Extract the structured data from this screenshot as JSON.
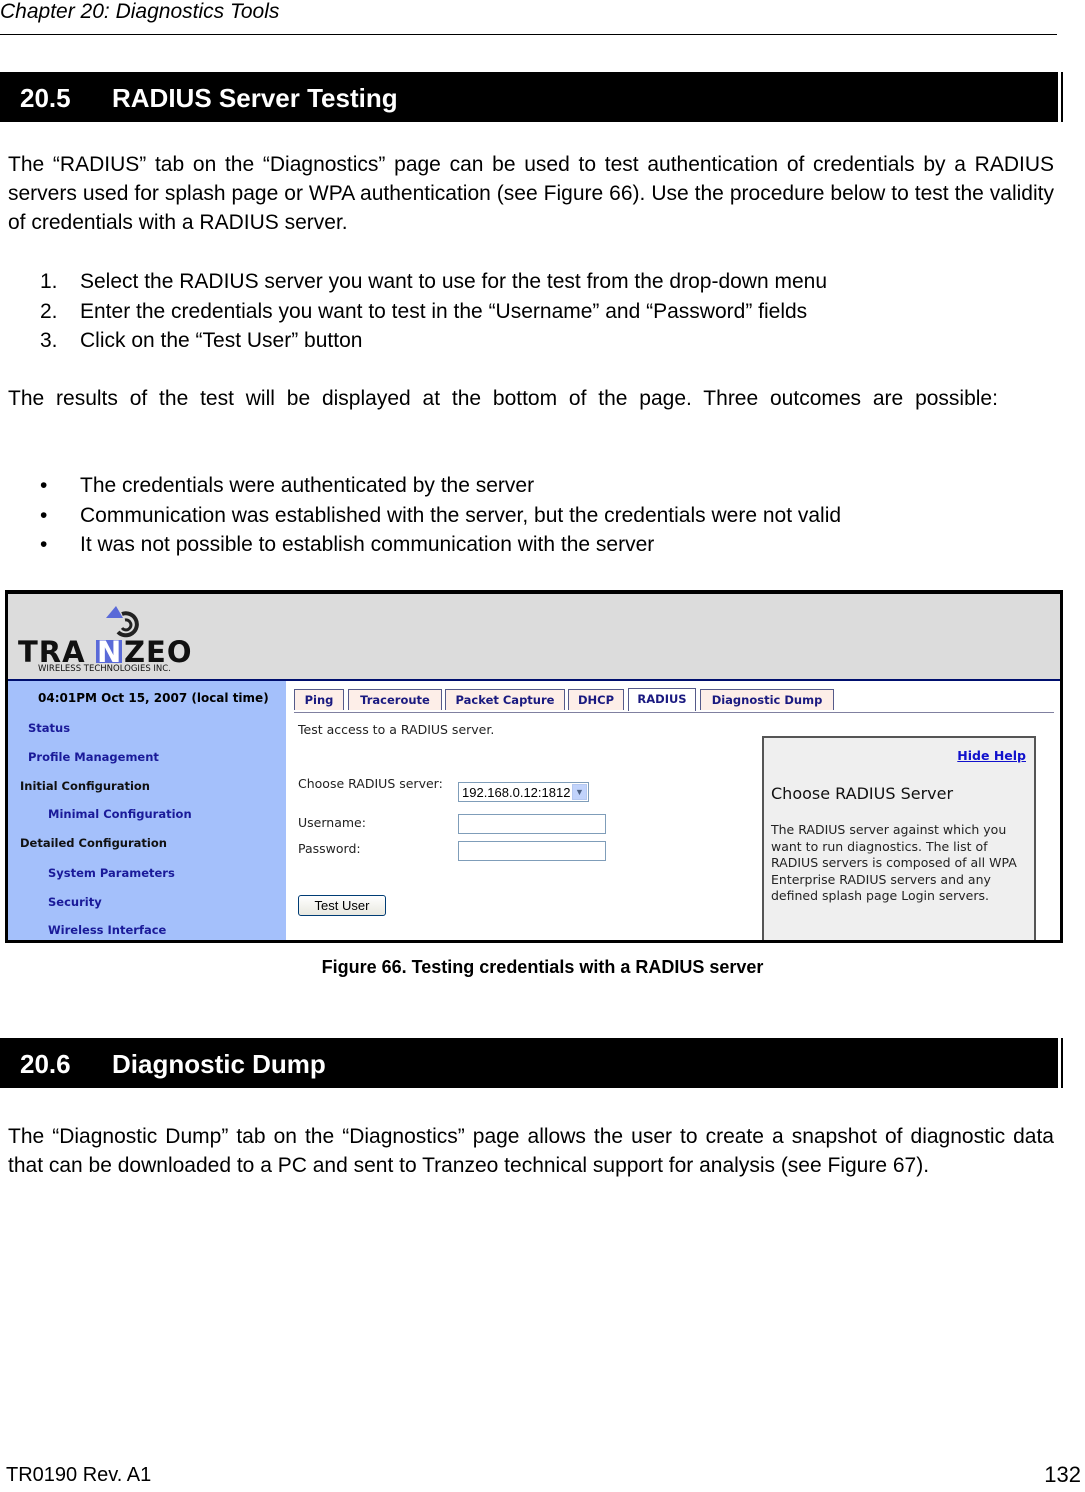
{
  "page": {
    "running_head": "Chapter 20: Diagnostics Tools",
    "footer_doc": "TR0190 Rev. A1",
    "page_number": "132"
  },
  "section_1": {
    "number": "20.5",
    "title": "RADIUS Server Testing",
    "intro": "The “RADIUS” tab on the “Diagnostics” page can be used to test authentication of credentials by a RADIUS servers used for splash page or WPA authentication (see Figure 66). Use the procedure below to test the validity of credentials with a RADIUS server.",
    "steps": [
      {
        "marker": "1.",
        "text": "Select the RADIUS server you want to use for the test from the drop-down menu"
      },
      {
        "marker": "2.",
        "text": "Enter the credentials you want to test in the “Username” and “Password” fields"
      },
      {
        "marker": "3.",
        "text": "Click on the “Test User” button"
      }
    ],
    "results_text": "The results of the test will be displayed at the bottom of the page. Three outcomes are possible:",
    "outcomes": [
      {
        "marker": "•",
        "text": "The credentials were authenticated by the server"
      },
      {
        "marker": "•",
        "text": "Communication was established with the server, but the credentials were not valid"
      },
      {
        "marker": "•",
        "text": "It was not possible to establish communication with the server"
      }
    ]
  },
  "figure": {
    "caption": "Figure 66. Testing credentials with a RADIUS server",
    "logo": {
      "brand": "TRANZEO",
      "tagline": "WIRELESS TECHNOLOGIES INC.",
      "icon": "antenna-signal-icon"
    },
    "sidebar": {
      "datetime": "04:01PM Oct 15, 2007 (local time)",
      "items": [
        {
          "label": "Status",
          "type": "link"
        },
        {
          "label": "Profile Management",
          "type": "link"
        },
        {
          "label": "Initial Configuration",
          "type": "heading"
        },
        {
          "label": "Minimal Configuration",
          "type": "sublink"
        },
        {
          "label": "Detailed Configuration",
          "type": "heading"
        },
        {
          "label": "System Parameters",
          "type": "sublink"
        },
        {
          "label": "Security",
          "type": "sublink"
        },
        {
          "label": "Wireless Interface",
          "type": "sublink"
        }
      ]
    },
    "tabs": [
      {
        "label": "Ping",
        "active": false
      },
      {
        "label": "Traceroute",
        "active": false
      },
      {
        "label": "Packet Capture",
        "active": false
      },
      {
        "label": "DHCP",
        "active": false
      },
      {
        "label": "RADIUS",
        "active": true
      },
      {
        "label": "Diagnostic Dump",
        "active": false
      }
    ],
    "form": {
      "description": "Test access to a RADIUS server.",
      "server_label": "Choose RADIUS server:",
      "server_value": "192.168.0.12:1812",
      "username_label": "Username:",
      "username_value": "",
      "password_label": "Password:",
      "password_value": "",
      "submit_label": "Test User"
    },
    "help": {
      "hide_link": "Hide Help",
      "title": "Choose RADIUS Server",
      "body": "The RADIUS server against which you want to run diagnostics. The list of RADIUS servers is composed of all WPA Enterprise RADIUS servers and any defined splash page Login servers."
    }
  },
  "section_2": {
    "number": "20.6",
    "title": "Diagnostic Dump",
    "intro": "The “Diagnostic Dump” tab on the “Diagnostics” page allows the user to create a snapshot of diagnostic data that can be downloaded to a PC and sent to Tranzeo technical support for analysis (see Figure 67)."
  }
}
